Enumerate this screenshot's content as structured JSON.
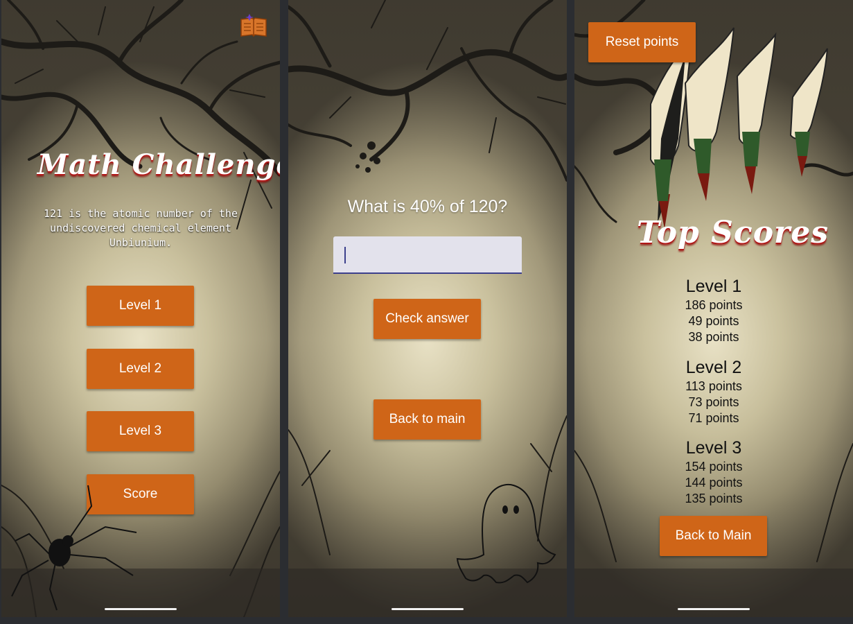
{
  "screen_home": {
    "title": "Math Challenge",
    "fact": "121 is the atomic number of the undiscovered chemical element Unbiunium.",
    "buttons": [
      "Level 1",
      "Level 2",
      "Level 3",
      "Score"
    ]
  },
  "screen_quiz": {
    "question": "What is 40% of 120?",
    "answer_value": "",
    "check_label": "Check answer",
    "back_label": "Back to main"
  },
  "screen_scores": {
    "reset_label": "Reset points",
    "title": "Top Scores",
    "levels": [
      {
        "name": "Level 1",
        "points": [
          "186 points",
          "49 points",
          "38 points"
        ]
      },
      {
        "name": "Level 2",
        "points": [
          "113 points",
          "73 points",
          "71 points"
        ]
      },
      {
        "name": "Level 3",
        "points": [
          "154 points",
          "144 points",
          "135 points"
        ]
      }
    ],
    "back_label": "Back to Main"
  },
  "colors": {
    "button": "#cf6518",
    "background": "#b9b193",
    "title_drip": "#b01818"
  },
  "icons": [
    "book-icon",
    "spider-icon",
    "ghost-icon",
    "claw-icon",
    "tree-icon"
  ]
}
